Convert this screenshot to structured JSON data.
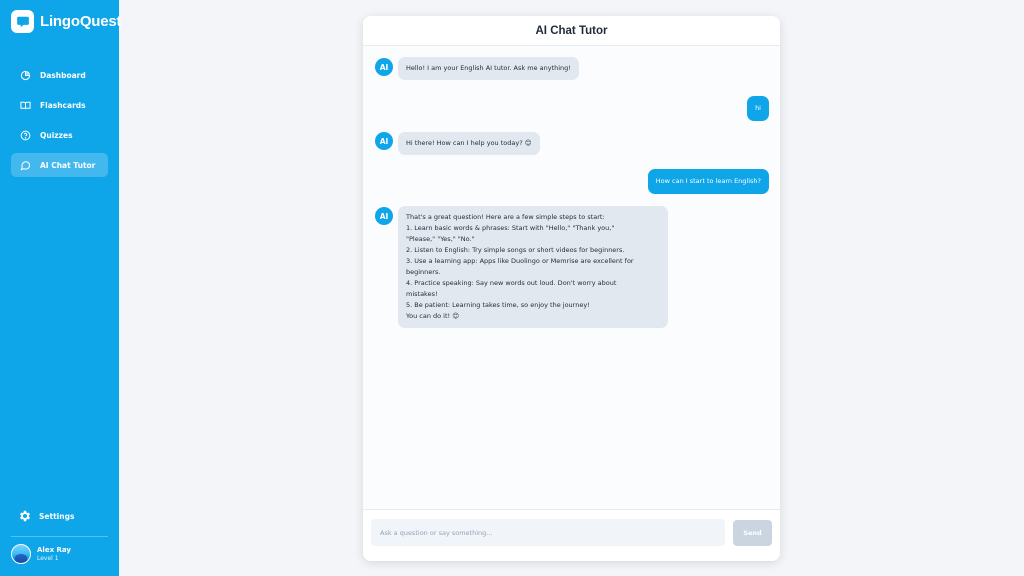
{
  "brand": {
    "name": "LingoQuest"
  },
  "nav": {
    "items": [
      {
        "label": "Dashboard",
        "icon": "dashboard-icon",
        "active": false
      },
      {
        "label": "Flashcards",
        "icon": "flashcards-icon",
        "active": false
      },
      {
        "label": "Quizzes",
        "icon": "quizzes-icon",
        "active": false
      },
      {
        "label": "AI Chat Tutor",
        "icon": "chat-icon",
        "active": true
      }
    ],
    "settings_label": "Settings"
  },
  "user": {
    "name": "Alex Ray",
    "level": "Level 1"
  },
  "chat": {
    "title": "AI Chat Tutor",
    "ai_avatar_label": "AI",
    "messages": [
      {
        "from": "ai",
        "text": "Hello! I am your English AI tutor. Ask me anything!"
      },
      {
        "from": "user",
        "text": "hi"
      },
      {
        "from": "ai",
        "text": "Hi there! How can I help you today? 😊"
      },
      {
        "from": "user",
        "text": "How can I start to learn English?"
      },
      {
        "from": "ai",
        "text": "That's a great question! Here are a few simple steps to start:\n1. Learn basic words & phrases: Start with \"Hello,\" \"Thank you,\"\n\"Please,\" \"Yes,\" \"No.\"\n2. Listen to English: Try simple songs or short videos for beginners.\n3. Use a learning app: Apps like Duolingo or Memrise are excellent for\nbeginners.\n4. Practice speaking: Say new words out loud. Don't worry about\nmistakes!\n5. Be patient: Learning takes time, so enjoy the journey!\nYou can do it! 😊"
      }
    ],
    "input_placeholder": "Ask a question or say something...",
    "send_label": "Send"
  },
  "colors": {
    "accent": "#0ea5e9",
    "ai_bubble": "#e2e8f0",
    "send_disabled": "#cbd5e1"
  }
}
